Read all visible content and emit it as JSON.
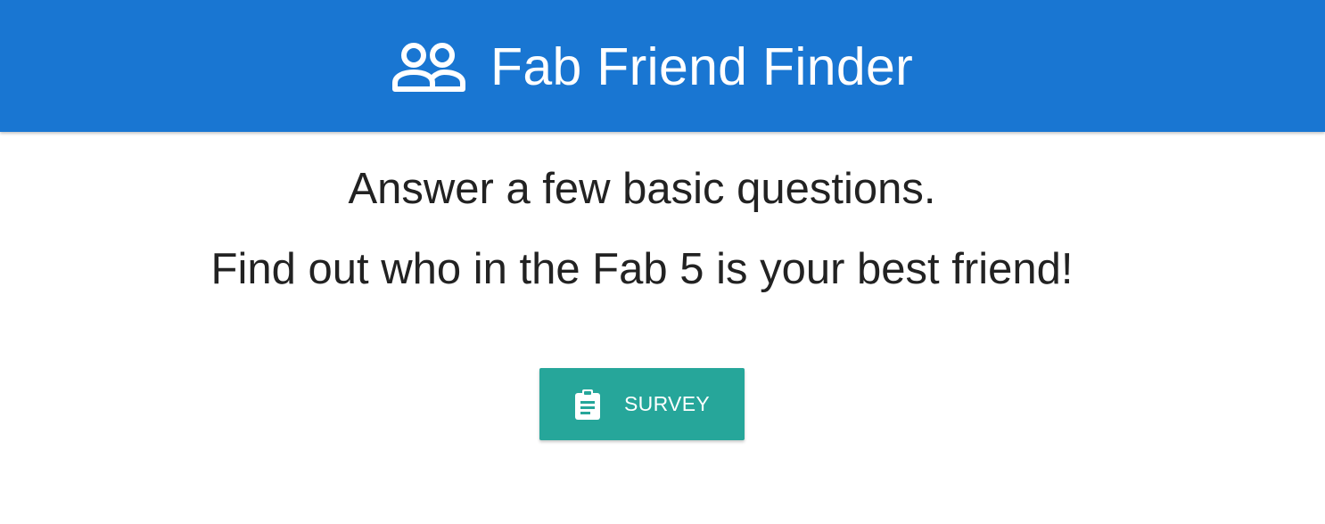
{
  "header": {
    "brand_icon": "people-outline-icon",
    "title": "Fab Friend Finder",
    "background": "#1976d2"
  },
  "main": {
    "line1": "Answer a few basic questions.",
    "line2": "Find out who in the Fab 5 is your best friend!"
  },
  "survey_button": {
    "icon": "clipboard-icon",
    "label": "SURVEY",
    "background": "#26a69a"
  }
}
